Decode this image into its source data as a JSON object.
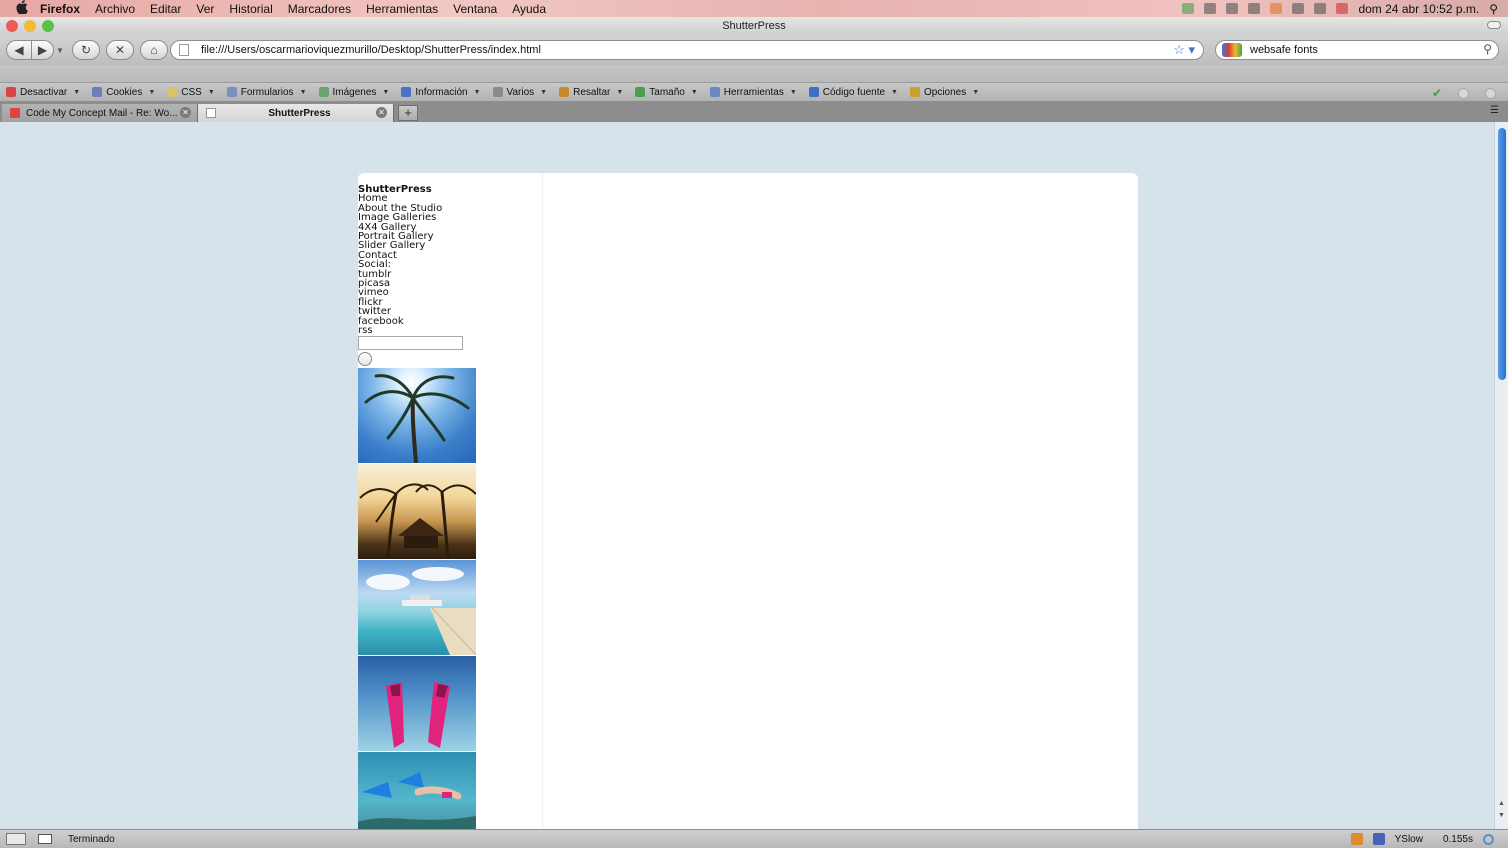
{
  "menubar": {
    "app": "Firefox",
    "items": [
      "Archivo",
      "Editar",
      "Ver",
      "Historial",
      "Marcadores",
      "Herramientas",
      "Ventana",
      "Ayuda"
    ],
    "clock": "dom 24 abr  10:52 p.m."
  },
  "window": {
    "title": "ShutterPress"
  },
  "nav": {
    "url": "file:///Users/oscarmarioviquezmurillo/Desktop/ShutterPress/index.html",
    "search_query": "websafe fonts"
  },
  "devbar": {
    "items": [
      {
        "label": "Desactivar",
        "icon": "disable-icon",
        "color": "#d94444"
      },
      {
        "label": "Cookies",
        "icon": "cookie-icon",
        "color": "#6b7fb8"
      },
      {
        "label": "CSS",
        "icon": "css-icon",
        "color": "#d9c36a"
      },
      {
        "label": "Formularios",
        "icon": "forms-icon",
        "color": "#7a8fbf"
      },
      {
        "label": "Imágenes",
        "icon": "images-icon",
        "color": "#6da26d"
      },
      {
        "label": "Información",
        "icon": "info-icon",
        "color": "#4a72c4"
      },
      {
        "label": "Varios",
        "icon": "misc-icon",
        "color": "#8a8a8a"
      },
      {
        "label": "Resaltar",
        "icon": "highlight-icon",
        "color": "#c98b2a"
      },
      {
        "label": "Tamaño",
        "icon": "resize-icon",
        "color": "#4aa04a"
      },
      {
        "label": "Herramientas",
        "icon": "tools-icon",
        "color": "#6a88c2"
      },
      {
        "label": "Código fuente",
        "icon": "source-icon",
        "color": "#3f6fc4"
      },
      {
        "label": "Opciones",
        "icon": "options-icon",
        "color": "#c9a02a"
      }
    ]
  },
  "tabs": [
    {
      "label": "Code My Concept Mail - Re: Wo...",
      "active": false
    },
    {
      "label": "ShutterPress",
      "active": true
    }
  ],
  "page": {
    "site_title": "ShutterPress",
    "nav_links": [
      "Home",
      "About the Studio",
      "Image Galleries",
      "4X4 Gallery",
      "Portrait Gallery",
      "Slider Gallery",
      "Contact",
      "Social:",
      "tumblr",
      "picasa",
      "vimeo",
      "flickr",
      "twitter",
      "facebook",
      "rss"
    ],
    "thumbnails": [
      "palm-tree-sky",
      "beach-hut-sunset",
      "pier-yacht",
      "pink-fins-water",
      "snorkeler-underwater"
    ]
  },
  "statusbar": {
    "status": "Terminado",
    "yslow_label": "YSlow",
    "load_time": "0.155s"
  }
}
